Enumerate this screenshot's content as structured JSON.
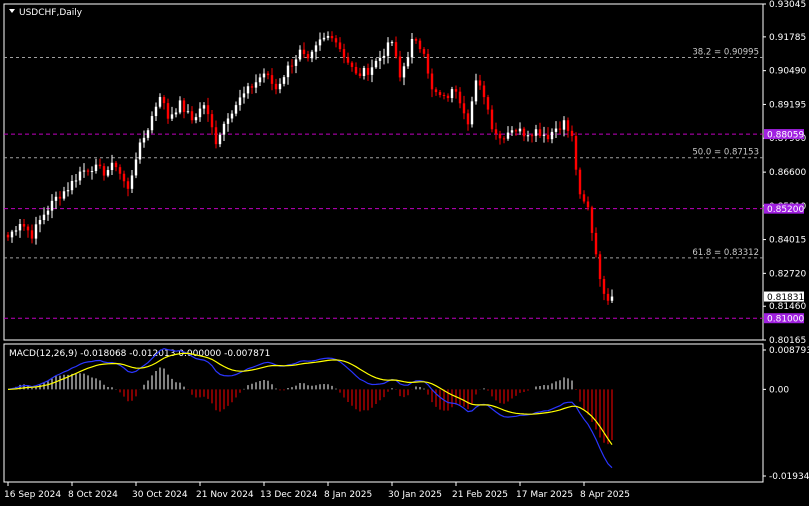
{
  "window": {
    "symbol_title": "USDCHF,Daily",
    "indicator_title": "MACD(12,26,9) -0.018068 -0.012013 0.000000 -0.007871"
  },
  "colors": {
    "background": "#000000",
    "grid": "#ffffff",
    "bull": "#ffffff",
    "bear": "#ff0000",
    "fib": "#a0a0a0",
    "sr": "#c000c0",
    "macd_main": "#2a35ff",
    "macd_signal": "#ffff00",
    "badge_purple": "#a020e0",
    "badge_white": "#ffffff"
  },
  "chart_data": [
    {
      "type": "candlestick",
      "title": "USDCHF,Daily",
      "ylim": [
        0.80165,
        0.93045
      ],
      "y_ticks": [
        "0.93045",
        "0.91785",
        "0.90490",
        "0.89195",
        "0.87900",
        "0.86600",
        "0.85310",
        "0.84015",
        "0.82720",
        "0.81460",
        "0.80165"
      ],
      "x_ticks": [
        "16 Sep 2024",
        "8 Oct 2024",
        "30 Oct 2024",
        "21 Nov 2024",
        "13 Dec 2024",
        "8 Jan 2025",
        "30 Jan 2025",
        "21 Feb 2025",
        "17 Mar 2025",
        "8 Apr 2025"
      ],
      "x_tick_index": [
        0,
        16,
        32,
        48,
        64,
        80,
        96,
        112,
        128,
        144
      ],
      "fib_levels": [
        {
          "label": "38.2 = 0.90995",
          "value": 0.90995
        },
        {
          "label": "50.0 = 0.87153",
          "value": 0.87153
        },
        {
          "label": "61.8 = 0.83312",
          "value": 0.83312
        }
      ],
      "sr_levels": [
        {
          "label": "0.88059",
          "value": 0.88059
        },
        {
          "label": "0.85200",
          "value": 0.852
        },
        {
          "label": "0.81000",
          "value": 0.81
        }
      ],
      "current_price": {
        "label": "0.81831",
        "value": 0.81831
      },
      "anchors": [
        [
          0,
          0.841
        ],
        [
          3,
          0.847
        ],
        [
          6,
          0.842
        ],
        [
          9,
          0.85
        ],
        [
          12,
          0.856
        ],
        [
          15,
          0.86
        ],
        [
          18,
          0.866
        ],
        [
          21,
          0.868
        ],
        [
          24,
          0.866
        ],
        [
          27,
          0.869
        ],
        [
          30,
          0.859
        ],
        [
          32,
          0.872
        ],
        [
          35,
          0.883
        ],
        [
          38,
          0.896
        ],
        [
          40,
          0.887
        ],
        [
          43,
          0.892
        ],
        [
          46,
          0.886
        ],
        [
          49,
          0.892
        ],
        [
          52,
          0.878
        ],
        [
          55,
          0.888
        ],
        [
          58,
          0.894
        ],
        [
          61,
          0.899
        ],
        [
          64,
          0.904
        ],
        [
          67,
          0.898
        ],
        [
          70,
          0.906
        ],
        [
          73,
          0.912
        ],
        [
          75,
          0.908
        ],
        [
          78,
          0.916
        ],
        [
          81,
          0.919
        ],
        [
          84,
          0.911
        ],
        [
          87,
          0.903
        ],
        [
          90,
          0.905
        ],
        [
          93,
          0.91
        ],
        [
          96,
          0.916
        ],
        [
          98,
          0.902
        ],
        [
          101,
          0.916
        ],
        [
          104,
          0.913
        ],
        [
          106,
          0.897
        ],
        [
          109,
          0.894
        ],
        [
          112,
          0.898
        ],
        [
          115,
          0.886
        ],
        [
          117,
          0.9
        ],
        [
          119,
          0.896
        ],
        [
          121,
          0.884
        ],
        [
          123,
          0.879
        ],
        [
          126,
          0.883
        ],
        [
          129,
          0.881
        ],
        [
          132,
          0.882
        ],
        [
          135,
          0.88
        ],
        [
          137,
          0.883
        ],
        [
          139,
          0.885
        ],
        [
          141,
          0.879
        ],
        [
          143,
          0.856
        ],
        [
          145,
          0.852
        ],
        [
          147,
          0.835
        ],
        [
          149,
          0.818
        ],
        [
          151,
          0.8183
        ]
      ],
      "candle_count": 152
    },
    {
      "type": "macd",
      "title": "MACD(12,26,9)",
      "params": [
        12,
        26,
        9
      ],
      "values": {
        "main": -0.018068,
        "signal": -0.012013,
        "histogram": -0.007871
      },
      "ylim": [
        -0.019347,
        0.008793
      ],
      "y_ticks": [
        "0.008793",
        "0.00",
        "-0.019347"
      ]
    }
  ]
}
